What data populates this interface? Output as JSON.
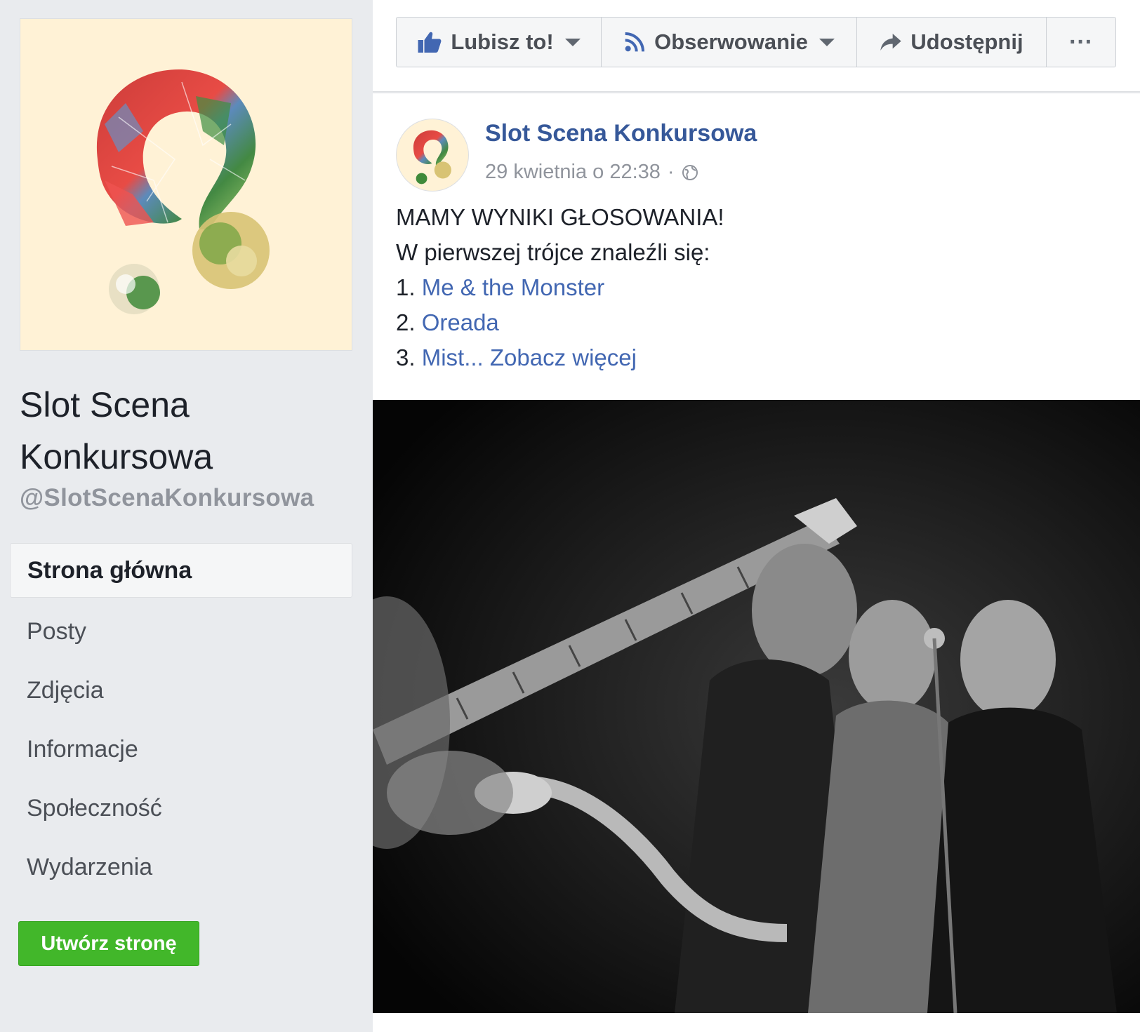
{
  "sidebar": {
    "page_name_line1": "Slot Scena",
    "page_name_line2": "Konkursowa",
    "page_handle": "@SlotScenaKonkursowa",
    "nav_items": [
      {
        "label": "Strona główna",
        "active": true
      },
      {
        "label": "Posty",
        "active": false
      },
      {
        "label": "Zdjęcia",
        "active": false
      },
      {
        "label": "Informacje",
        "active": false
      },
      {
        "label": "Społeczność",
        "active": false
      },
      {
        "label": "Wydarzenia",
        "active": false
      }
    ],
    "create_page_label": "Utwórz stronę"
  },
  "action_bar": {
    "like_label": "Lubisz to!",
    "follow_label": "Obserwowanie",
    "share_label": "Udostępnij",
    "more_label": "···"
  },
  "post": {
    "author": "Slot Scena Konkursowa",
    "timestamp": "29 kwietnia o 22:38",
    "meta_separator": "·",
    "line1": "MAMY WYNIKI GŁOSOWANIA!",
    "line2": "W pierwszej trójce znaleźli się:",
    "item1_num": "1.",
    "item1_link": "Me & the Monster",
    "item2_num": "2.",
    "item2_link": "Oreada",
    "item3_num": "3.",
    "item3_link": "Mist...",
    "see_more": "Zobacz więcej"
  },
  "colors": {
    "link": "#4267b2",
    "author": "#365899",
    "create_button": "#42b72a",
    "page_bg": "#e9ebee"
  },
  "icons": {
    "like": "thumbs-up-icon",
    "follow": "rss-icon",
    "share": "share-arrow-icon",
    "privacy": "globe-icon"
  }
}
